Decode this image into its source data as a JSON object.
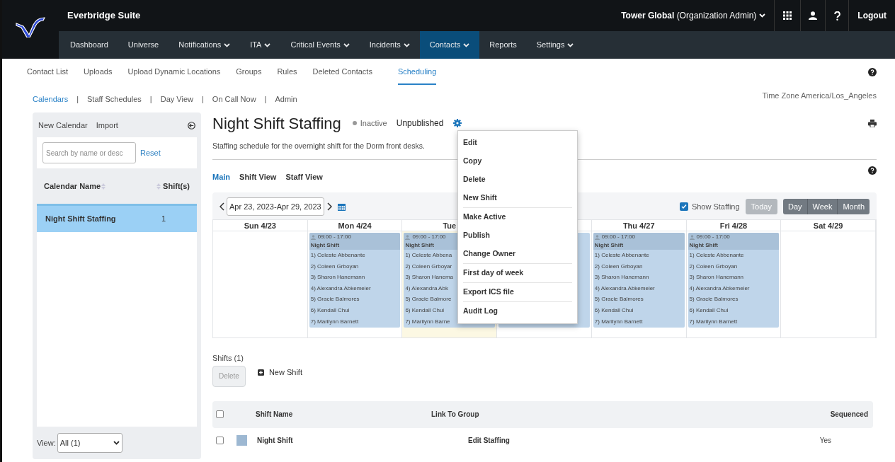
{
  "header": {
    "suite": "Everbridge Suite",
    "org": "Tower Global",
    "role": "(Organization Admin)",
    "logout": "Logout"
  },
  "nav": [
    {
      "label": "Dashboard",
      "dropdown": false,
      "selected": false
    },
    {
      "label": "Universe",
      "dropdown": false,
      "selected": false
    },
    {
      "label": "Notifications",
      "dropdown": true,
      "selected": false
    },
    {
      "label": "ITA",
      "dropdown": true,
      "selected": false
    },
    {
      "label": "Critical Events",
      "dropdown": true,
      "selected": false
    },
    {
      "label": "Incidents",
      "dropdown": true,
      "selected": false
    },
    {
      "label": "Contacts",
      "dropdown": true,
      "selected": true
    },
    {
      "label": "Reports",
      "dropdown": false,
      "selected": false
    },
    {
      "label": "Settings",
      "dropdown": true,
      "selected": false
    }
  ],
  "subnav": [
    {
      "label": "Contact List",
      "selected": false
    },
    {
      "label": "Uploads",
      "selected": false
    },
    {
      "label": "Upload Dynamic Locations",
      "selected": false
    },
    {
      "label": "Groups",
      "selected": false
    },
    {
      "label": "Rules",
      "selected": false
    },
    {
      "label": "Deleted Contacts",
      "selected": false
    },
    {
      "label": "Scheduling",
      "selected": true
    }
  ],
  "scheduling_nav": [
    {
      "label": "Calendars",
      "selected": true
    },
    {
      "separator": "|",
      "label": "Staff Schedules",
      "selected": false
    },
    {
      "separator": "|",
      "label": "Day View",
      "selected": false
    },
    {
      "separator": "|",
      "label": "On Call Now",
      "selected": false
    },
    {
      "separator": "|",
      "label": "Admin",
      "selected": false
    }
  ],
  "time_zone": "Time Zone America/Los_Angeles",
  "sidebar": {
    "actions": [
      "New Calendar",
      "Import"
    ],
    "search": {
      "placeholder": "Search by name or desc"
    },
    "reset": "Reset",
    "columns": [
      "Calendar Name",
      "Shift(s)"
    ],
    "rows": [
      {
        "name": "Night Shift Staffing",
        "shifts": "1",
        "selected": true
      }
    ],
    "view_label": "View:",
    "view_value": "All (1)"
  },
  "calendar": {
    "title": "Night Shift Staffing",
    "status": "Inactive",
    "publish_state": "Unpublished",
    "description": "Staffing schedule for the overnight shift for the Dorm front desks.",
    "views": [
      {
        "label": "Main",
        "selected": true
      },
      {
        "label": "Shift View",
        "selected": false
      },
      {
        "label": "Staff View",
        "selected": false
      }
    ],
    "range": "Apr 23, 2023-Apr 29, 2023",
    "show_staffing": {
      "label": "Show Staffing",
      "checked": true
    },
    "today": "Today",
    "modes": [
      "Day",
      "Week",
      "Month"
    ],
    "days": [
      {
        "header": "Sun 4/23",
        "today": false
      },
      {
        "header": "Mon 4/24",
        "today": false,
        "shift": {
          "time": "09:00 - 17:00",
          "name": "Night Shift",
          "staff": [
            "1) Celeste Abbenante",
            "2) Coleen Grboyan",
            "3) Sharon Hanemann",
            "4) Alexandra Abkemeier",
            "5) Gracie Balmores",
            "6) Kendall Chui",
            "7) Marilynn Barnett"
          ]
        }
      },
      {
        "header": "Tue",
        "today": true,
        "shift": {
          "time": "09:00 - 17:00",
          "name": "Night Shift",
          "staff": [
            "1) Celeste Abbena",
            "2) Coleen Grboyar",
            "3) Sharon Hanema",
            "4) Alexandra Abk",
            "5) Gracie Balmore",
            "6) Kendall Chui",
            "7) Marilynn Barne"
          ]
        }
      },
      {
        "today": false,
        "covered_shift": true
      },
      {
        "header": "Thu 4/27",
        "today": false,
        "shift": {
          "time": "09:00 - 17:00",
          "name": "Night Shift",
          "staff": [
            "1) Celeste Abbenante",
            "2) Coleen Grboyan",
            "3) Sharon Hanemann",
            "4) Alexandra Abkemeier",
            "5) Gracie Balmores",
            "6) Kendall Chui",
            "7) Marilynn Barnett"
          ]
        }
      },
      {
        "header": "Fri 4/28",
        "today": false,
        "shift": {
          "time": "09:00 - 17:00",
          "name": "Night Shift",
          "staff": [
            "1) Celeste Abbenante",
            "2) Coleen Grboyan",
            "3) Sharon Hanemann",
            "4) Alexandra Abkemeier",
            "5) Gracie Balmores",
            "6) Kendall Chui",
            "7) Marilynn Barnett"
          ]
        }
      },
      {
        "header": "Sat 4/29",
        "today": false
      }
    ]
  },
  "gear_menu": [
    [
      "Edit",
      "Copy",
      "Delete",
      "New Shift"
    ],
    [
      "Make Active",
      "Publish",
      "Change Owner"
    ],
    [
      "First day of week"
    ],
    [
      "Export ICS file"
    ],
    [
      "Audit Log"
    ]
  ],
  "shifts": {
    "title": "Shifts (1)",
    "delete": "Delete",
    "new_shift": "New Shift",
    "columns": [
      "Shift Name",
      "Link To Group",
      "Sequenced"
    ],
    "select_all_checked": false,
    "rows": [
      {
        "name": "Night Shift",
        "color": "#9db8d2",
        "link": "Edit Staffing",
        "sequenced": "Yes",
        "checked": false
      }
    ]
  }
}
